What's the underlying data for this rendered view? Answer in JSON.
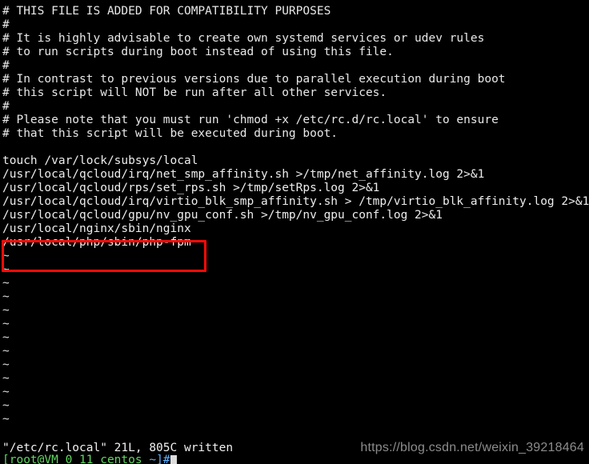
{
  "terminal": {
    "app": "vim",
    "background_color": "#000000",
    "foreground_color": "#e6e6e6",
    "file_lines": [
      "# THIS FILE IS ADDED FOR COMPATIBILITY PURPOSES",
      "#",
      "# It is highly advisable to create own systemd services or udev rules",
      "# to run scripts during boot instead of using this file.",
      "#",
      "# In contrast to previous versions due to parallel execution during boot",
      "# this script will NOT be run after all other services.",
      "#",
      "# Please note that you must run 'chmod +x /etc/rc.d/rc.local' to ensure",
      "# that this script will be executed during boot.",
      "",
      "touch /var/lock/subsys/local",
      "/usr/local/qcloud/irq/net_smp_affinity.sh >/tmp/net_affinity.log 2>&1",
      "/usr/local/qcloud/rps/set_rps.sh >/tmp/setRps.log 2>&1",
      "/usr/local/qcloud/irq/virtio_blk_smp_affinity.sh > /tmp/virtio_blk_affinity.log 2>&1",
      "/usr/local/qcloud/gpu/nv_gpu_conf.sh >/tmp/nv_gpu_conf.log 2>&1",
      "/usr/local/nginx/sbin/nginx",
      "/usr/local/php/sbin/php-fpm"
    ],
    "empty_line_marker": "~",
    "empty_line_count": 13,
    "status_line": "\"/etc/rc.local\" 21L, 805C written",
    "prompt": {
      "user_host": "[root@VM_0_11_centos",
      "path": "~]#",
      "cursor": ""
    }
  },
  "annotation": {
    "type": "rectangle-highlight",
    "color": "#fb0b06",
    "border_width_px": 3,
    "highlighted_text": "/usr/local/php/sbin/php-fpm"
  },
  "watermark": {
    "text": "https://blog.csdn.net/weixin_39218464",
    "color": "#8c8c8c"
  }
}
